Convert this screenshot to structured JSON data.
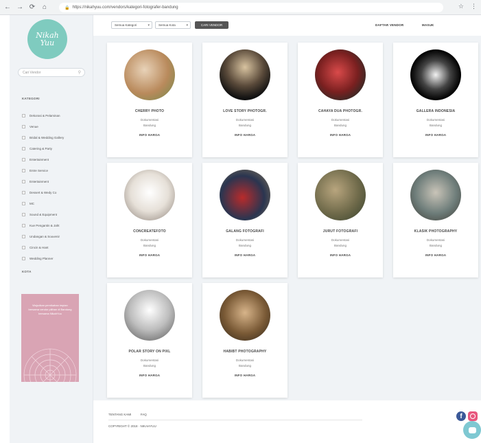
{
  "browser": {
    "url": "https://nikahyuu.com/vendors/kategori-fotografer-bandung",
    "back_icon": "arrow-left-icon",
    "forward_icon": "arrow-right-icon",
    "reload_icon": "reload-icon",
    "home_icon": "home-icon"
  },
  "brand": {
    "logo_line1": "Nikah",
    "logo_line2": "Yuu"
  },
  "sidebar": {
    "search_placeholder": "Cari Vendor",
    "kategori_title": "KATEGORI",
    "categories": [
      "Dekorasi & Pelaminan",
      "Venue",
      "Bridal & Wedding Gallery",
      "Catering & Party",
      "Entertainment",
      "Entre Service",
      "Entertainment",
      "Dessert & Wedy Co",
      "MC",
      "Sound & Equipment",
      "Kue Pengantin & Jaht",
      "Undangan & Souvenir",
      "Cincin & Hant",
      "Wedding Planner"
    ],
    "kota_title": "KOTA",
    "ad_text": "Wujudkan pernikahan impian bersama vendor pilihan di Bandung bersama NikahYuu"
  },
  "toolbar": {
    "kategori_select": "Semua Kategori",
    "kota_select": "Semua Kota",
    "search_button": "CARI VENDOR",
    "link_daftar": "DAFTAR VENDOR",
    "link_masuk": "MASUK"
  },
  "vendors": [
    {
      "name": "CHERRY PHOTO",
      "type": "Dokumentasi",
      "city": "Bandung",
      "price": "INFO HARGA"
    },
    {
      "name": "LOVE STORY PHOTOGR.",
      "type": "Dokumentasi",
      "city": "Bandung",
      "price": "INFO HARGA"
    },
    {
      "name": "CAHAYA DUA PHOTOGR.",
      "type": "Dokumentasi",
      "city": "Bandung",
      "price": "INFO HARGA"
    },
    {
      "name": "GALLERA INDONESIA",
      "type": "Dokumentasi",
      "city": "Bandung",
      "price": "INFO HARGA"
    },
    {
      "name": "CONCREATEFOTO",
      "type": "Dokumentasi",
      "city": "Bandung",
      "price": "INFO HARGA"
    },
    {
      "name": "GALANG FOTOGRAFI",
      "type": "Dokumentasi",
      "city": "Bandung",
      "price": "INFO HARGA"
    },
    {
      "name": "JURUT FOTOGRAFI",
      "type": "Dokumentasi",
      "city": "Bandung",
      "price": "INFO HARGA"
    },
    {
      "name": "KLASIK PHOTOGRAPHY",
      "type": "Dokumentasi",
      "city": "Bandung",
      "price": "INFO HARGA"
    },
    {
      "name": "POLAR STORY ON PIXL",
      "type": "Dokumentasi",
      "city": "Bandung",
      "price": "INFO HARGA"
    },
    {
      "name": "HABIBT PHOTOGRAPHY",
      "type": "Dokumentasi",
      "city": "Bandung",
      "price": "INFO HARGA"
    }
  ],
  "footer": {
    "left1": "TENTANG KAMI",
    "left1b": "FAQ",
    "copyright": "COPYRIGHT © 2018 · NIKAHYUU"
  },
  "colors": {
    "brand_teal": "#7fcbbf",
    "ad_pink": "#d9a4b4",
    "facebook": "#3b5998",
    "instagram": "#e8577e",
    "chat": "#7ec8d2"
  }
}
